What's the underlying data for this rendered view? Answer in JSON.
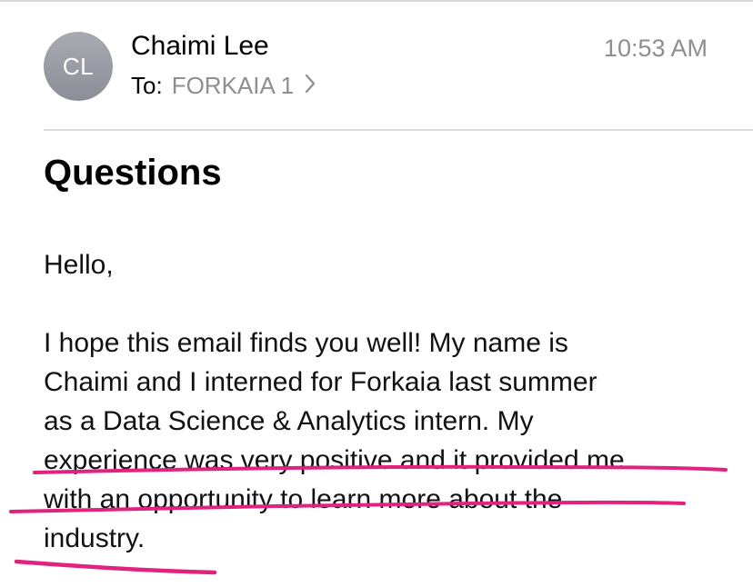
{
  "message": {
    "sender": {
      "initials": "CL",
      "name": "Chaimi Lee"
    },
    "recipient": {
      "prefix": "To:",
      "name": "FORKAIA 1"
    },
    "time": "10:53 AM",
    "subject": "Questions",
    "greeting": "Hello,",
    "body_lines": [
      "I hope this email finds you well! My name is",
      "Chaimi and I interned for Forkaia last summer",
      "as a Data Science & Analytics intern. My",
      "experience was very positive and it provided me",
      "with an opportunity to learn more about the",
      "industry."
    ]
  },
  "colors": {
    "highlight_underline": "#e0237f",
    "secondary_text": "#8e8e93",
    "avatar": "#9a9ca4"
  },
  "icons": [
    "chevron-right-icon"
  ]
}
